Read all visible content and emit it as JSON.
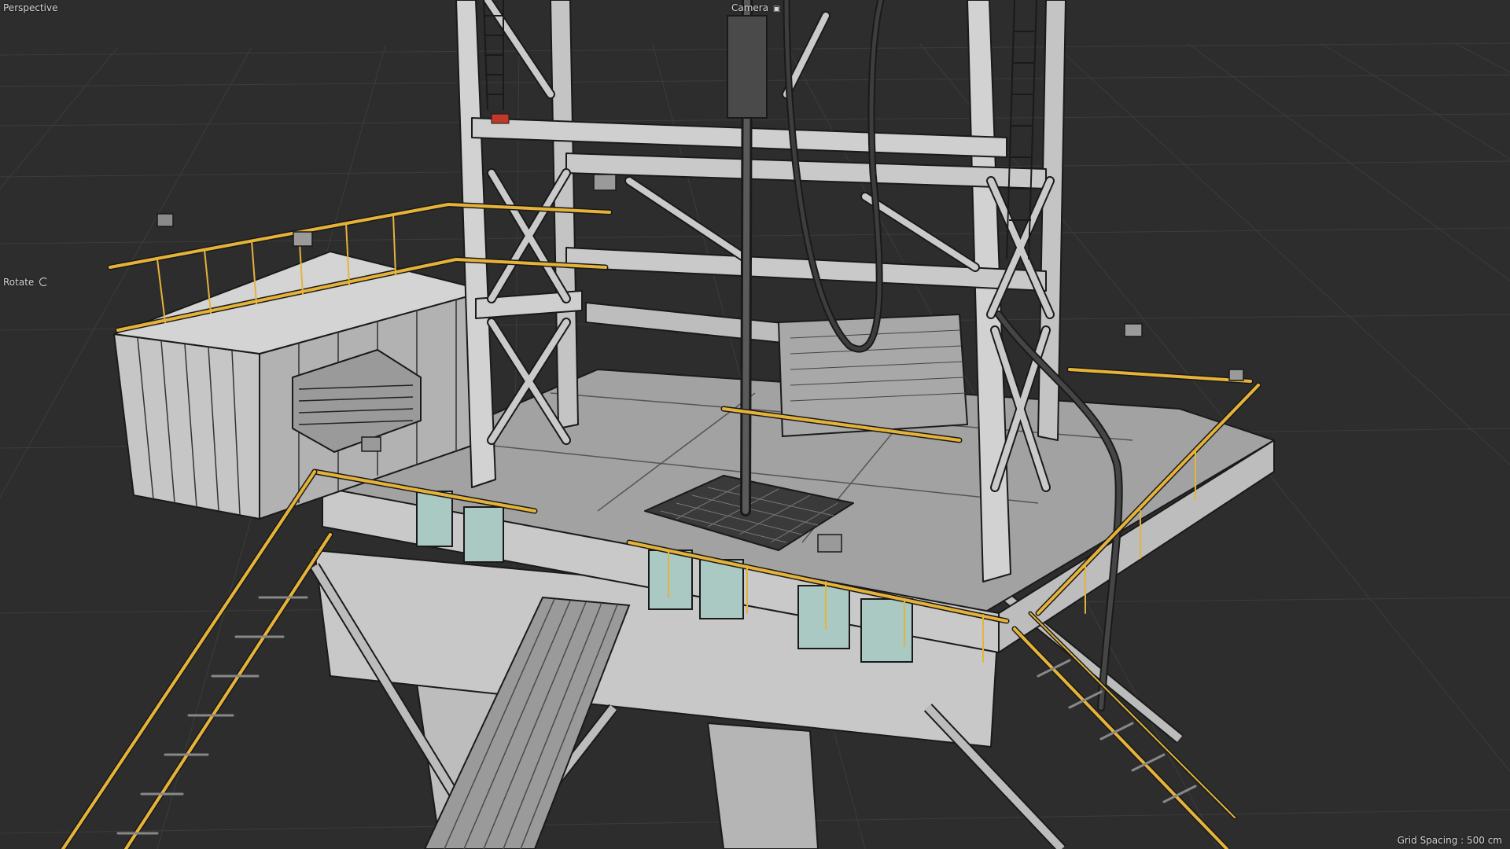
{
  "viewport": {
    "view_label": "Perspective",
    "camera_label": "Camera",
    "camera_icon": "camera-lock-icon",
    "mode_label": "Rotate",
    "mode_icon": "rotate-icon",
    "grid_spacing": "Grid Spacing : 500 cm"
  },
  "colors": {
    "background": "#2d2d2d",
    "grid": "#3b3b3b",
    "steel": "#c4c4c4",
    "steel_dark": "#8e8e8e",
    "deck": "#9b9b9b",
    "outline": "#1a1a1a",
    "railing": "#e6b33a",
    "glass": "#a9c9c2"
  }
}
